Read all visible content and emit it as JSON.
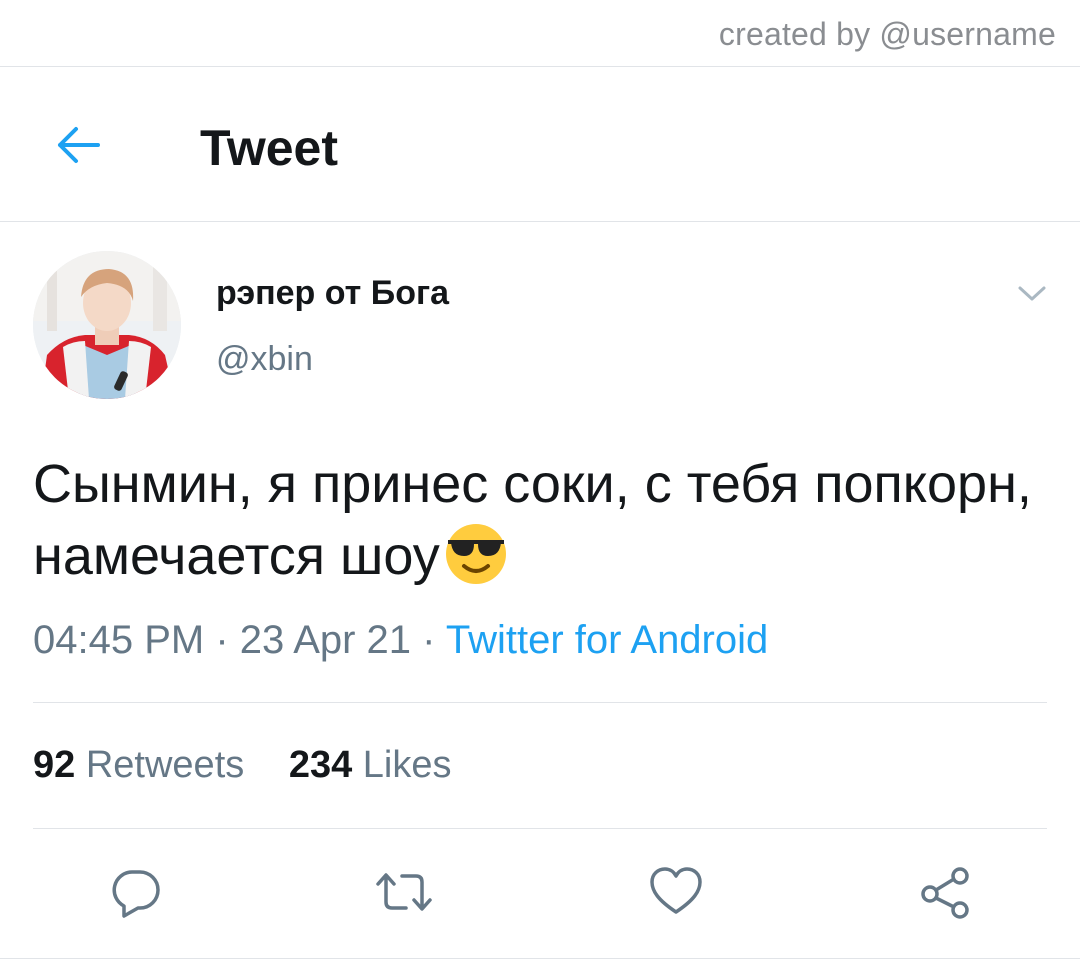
{
  "credit": "created by @username",
  "header": {
    "title": "Tweet",
    "back_icon": "arrow-left-icon"
  },
  "tweet": {
    "display_name": "рэпер от Бога",
    "handle": "@xbin",
    "text": "Сынмин, я принес соки, с тебя попкорн, намечается шоу",
    "emoji": "smiling-face-with-sunglasses",
    "time": "04:45 PM",
    "date": "23 Apr 21",
    "separator": "·",
    "source": "Twitter for Android",
    "retweets_count": "92",
    "retweets_label": "Retweets",
    "likes_count": "234",
    "likes_label": "Likes"
  },
  "actions": [
    {
      "name": "reply",
      "icon": "reply-icon"
    },
    {
      "name": "retweet",
      "icon": "retweet-icon"
    },
    {
      "name": "like",
      "icon": "heart-icon"
    },
    {
      "name": "share",
      "icon": "share-icon"
    }
  ],
  "colors": {
    "accent": "#1da1f2",
    "text": "#14171a",
    "secondary": "#657786",
    "divider": "#e1e4e8",
    "icon_gray": "#657786"
  }
}
